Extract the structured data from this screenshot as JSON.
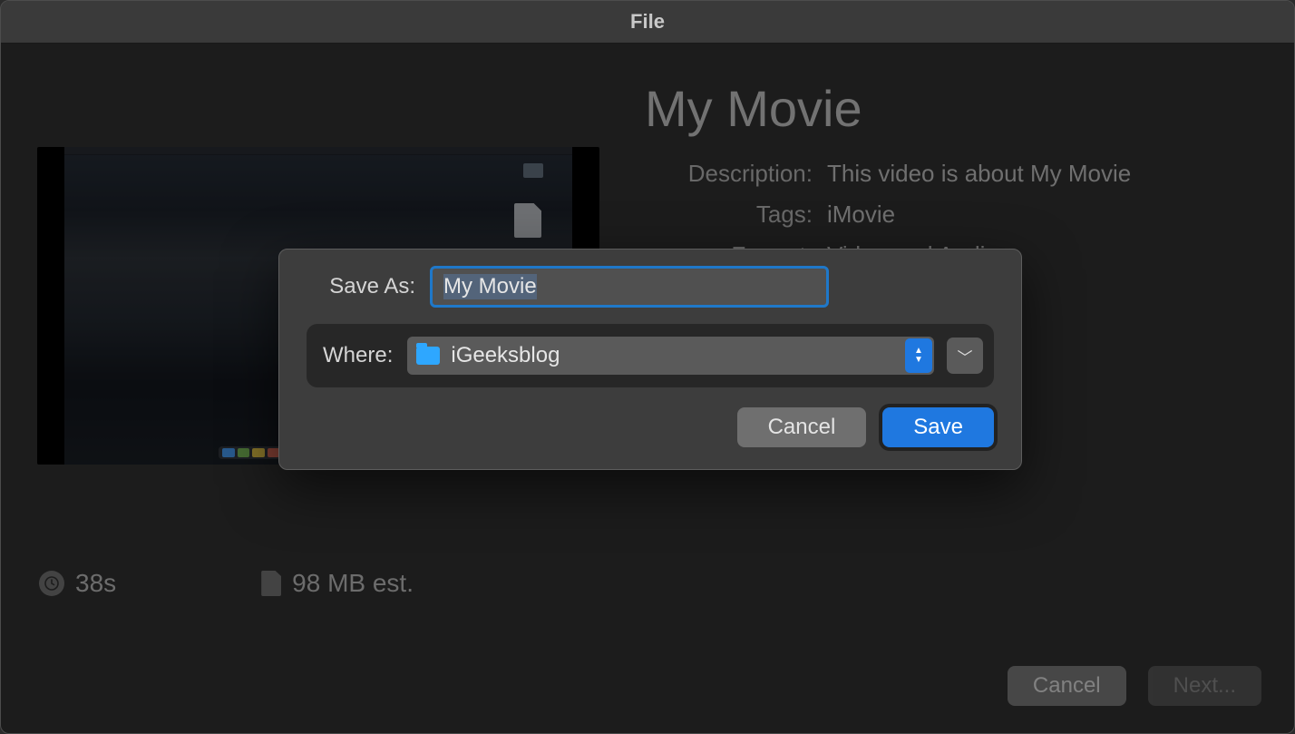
{
  "window": {
    "title": "File"
  },
  "movie": {
    "title": "My Movie",
    "description_label": "Description:",
    "description_value": "This video is about My Movie",
    "tags_label": "Tags:",
    "tags_value": "iMovie",
    "format_label": "Format:",
    "format_value": "Video and Audio"
  },
  "stats": {
    "duration": "38s",
    "size": "98 MB est."
  },
  "bg_buttons": {
    "cancel": "Cancel",
    "next": "Next..."
  },
  "sheet": {
    "saveas_label": "Save As:",
    "saveas_value": "My Movie",
    "where_label": "Where:",
    "where_value": "iGeeksblog",
    "cancel": "Cancel",
    "save": "Save"
  }
}
